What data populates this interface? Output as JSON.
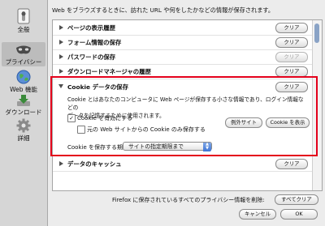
{
  "sidebar": {
    "items": [
      {
        "label": "全般",
        "icon": "switch-icon"
      },
      {
        "label": "プライバシー",
        "icon": "mask-icon"
      },
      {
        "label": "Web 機能",
        "icon": "globe-icon"
      },
      {
        "label": "ダウンロード",
        "icon": "download-icon"
      },
      {
        "label": "詳細",
        "icon": "gear-icon"
      }
    ],
    "selected": "プライバシー"
  },
  "description": "Web をブラウズするときに、訪れた URL や何をしたかなどの情報が保存されます。",
  "sections": [
    {
      "title": "ページの表示履歴",
      "clear_label": "クリア",
      "enabled": true
    },
    {
      "title": "フォーム情報の保存",
      "clear_label": "クリア",
      "enabled": true
    },
    {
      "title": "パスワードの保存",
      "clear_label": "クリア",
      "enabled": false
    },
    {
      "title": "ダウンロードマネージャの履歴",
      "clear_label": "クリア",
      "enabled": true
    }
  ],
  "cookie": {
    "title": "Cookie データの保存",
    "clear_label": "クリア",
    "description_line1": "Cookie とはあなたのコンピュータに Web ページが保存する小さな情報であり、ログイン情報などの",
    "description_line2": "データを記憶するために使用されます。",
    "enable_label": "Cookie を有効にする",
    "enable_checked": true,
    "original_only_label": "元の Web サイトからの Cookie のみ保存する",
    "original_only_checked": false,
    "exceptions_label": "例外サイト",
    "show_cookies_label": "Cookie を表示",
    "keep_label": "Cookie を保存する期間:",
    "keep_value": "サイトの指定期限まで"
  },
  "cache": {
    "title": "データのキャッシュ",
    "clear_label": "クリア"
  },
  "footer": {
    "clear_all_text": "Firefox に保存されているすべてのプライバシー情報を削除:",
    "clear_all_label": "すべてクリア",
    "cancel_label": "キャンセル",
    "ok_label": "OK"
  },
  "colors": {
    "highlight": "#e4001b",
    "selected_nav": "#bcbcbc"
  }
}
